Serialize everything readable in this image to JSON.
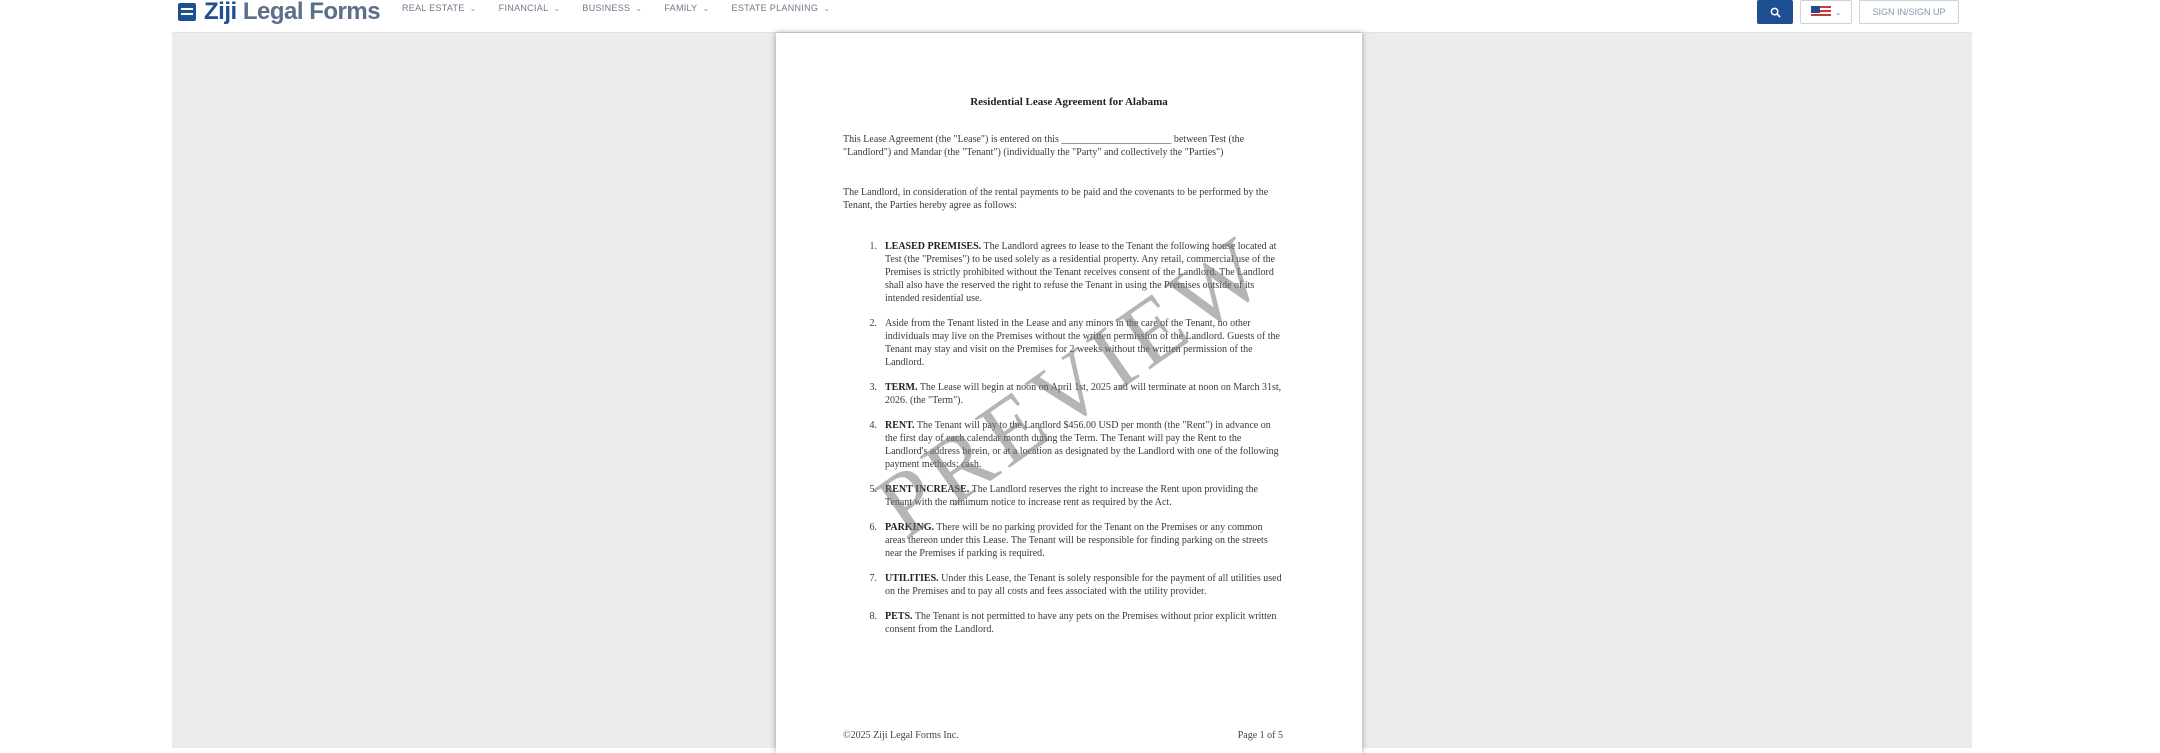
{
  "header": {
    "logo_bold": "Ziji",
    "logo_rest": " Legal Forms",
    "nav": [
      "REAL ESTATE",
      "FINANCIAL",
      "BUSINESS",
      "FAMILY",
      "ESTATE PLANNING"
    ],
    "signin": "SIGN IN/SIGN UP",
    "icons": {
      "search": "search-icon",
      "flag": "us-flag-icon"
    },
    "brand_color": "#1f4f93"
  },
  "document": {
    "title": "Residential Lease Agreement for Alabama",
    "intro": "This Lease Agreement (the \"Lease\") is entered on this ______________________ between Test (the \"Landlord\") and Mandar (the \"Tenant\") (individually the \"Party\" and collectively the \"Parties\")",
    "preamble": "The Landlord, in consideration of the rental payments to be paid and the covenants to be performed by the Tenant, the Parties hereby agree as follows:",
    "clauses": [
      {
        "num": "1.",
        "heading": "LEASED PREMISES.",
        "text": " The Landlord agrees to lease to the Tenant the following house located at Test (the \"Premises\") to be used solely as a residential property.  Any retail, commercial use of the Premises is strictly prohibited without the Tenant receives consent of the Landlord. The Landlord shall also have the reserved the right to refuse the Tenant in using the Premises outside of its intended residential use."
      },
      {
        "num": "2.",
        "heading": "",
        "text": "Aside from the Tenant listed in the Lease and any minors in the care of the Tenant, no other individuals may live on the Premises without the written permission of the Landlord.  Guests of the Tenant may stay and visit on the Premises for 2 weeks without the written permission of the Landlord."
      },
      {
        "num": "3.",
        "heading": "TERM.",
        "text": " The Lease will begin at noon on April 1st, 2025 and will terminate at noon on March 31st, 2026. (the \"Term\")."
      },
      {
        "num": "4.",
        "heading": "RENT.",
        "text": " The Tenant will pay to the Landlord $456.00 USD per month (the \"Rent\") in advance on the first day of each calendar month during the Term.  The Tenant will pay the Rent to the Landlord's address herein, or at a location as designated by the Landlord with one of the following payment methods: cash."
      },
      {
        "num": "5.",
        "heading": "RENT INCREASE.",
        "text": " The Landlord reserves the right to increase the Rent upon providing the Tenant with the minimum notice to increase rent as required by the Act."
      },
      {
        "num": "6.",
        "heading": "PARKING.",
        "text": " There will be no parking provided for the Tenant on the Premises or any common areas thereon under this Lease.  The Tenant will be responsible for finding parking on the streets near the Premises if parking is required."
      },
      {
        "num": "7.",
        "heading": "UTILITIES.",
        "text": " Under this Lease, the Tenant is solely responsible for the payment of all utilities used on the Premises and to pay all costs and fees associated with the utility provider."
      },
      {
        "num": "8.",
        "heading": "PETS.",
        "text": " The Tenant is not permitted to have any pets on the Premises without prior explicit written consent from the Landlord."
      }
    ],
    "watermark": "PREVIEW",
    "footer_left": "©2025 Ziji Legal Forms Inc.",
    "footer_right": "Page 1 of 5"
  }
}
